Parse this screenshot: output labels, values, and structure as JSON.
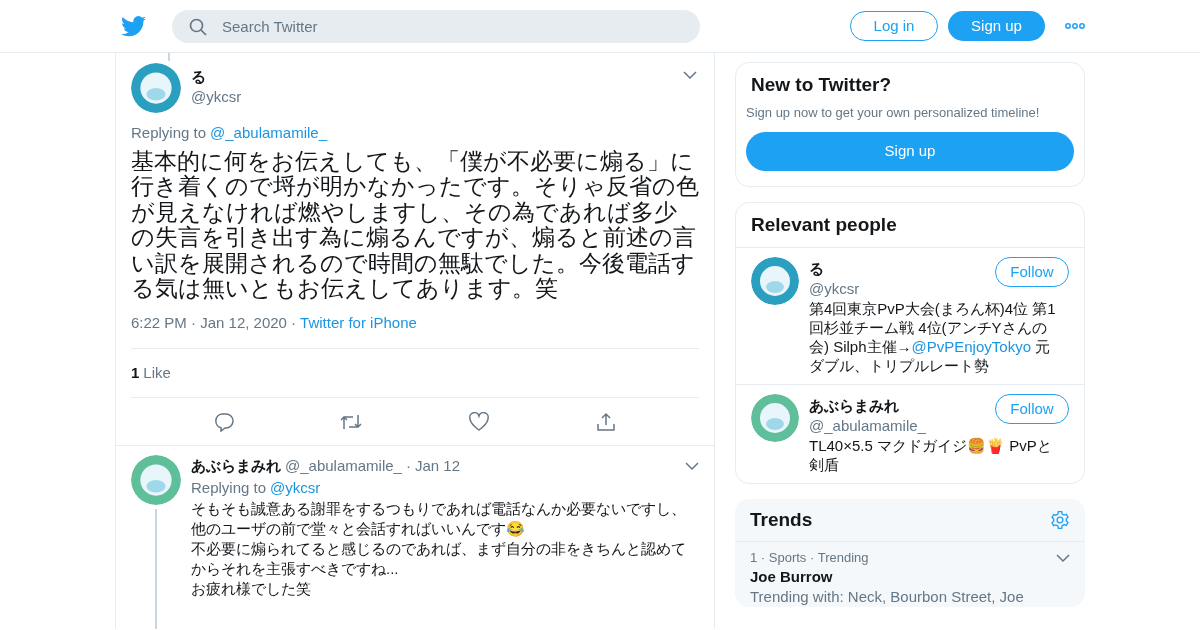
{
  "header": {
    "search_placeholder": "Search Twitter",
    "login": "Log in",
    "signup": "Sign up"
  },
  "main_tweet": {
    "name": "る",
    "handle": "@ykcsr",
    "replying_label": "Replying to",
    "replying_to": "@_abulamamile_",
    "text_lines": [
      "基本的に何をお伝えしても、「僕が不必要に煽る」に",
      "行き着くので埒が明かなかったです。そりゃ反省の色",
      "が見えなければ燃やしますし、その為であれば多少",
      "の失言を引き出す為に煽るんですが、煽ると前述の言",
      "い訳を展開されるので時間の無駄でした。今後電話す",
      "る気は無いともお伝えしてあります。笑"
    ],
    "time": "6:22 PM · Jan 12, 2020 ·",
    "source": "Twitter for iPhone",
    "like_count": "1",
    "like_label": "Like"
  },
  "reply": {
    "name": "あぶらまみれ",
    "handle": "@_abulamamile_",
    "separator": "·",
    "date": "Jan 12",
    "replying_label": "Replying to",
    "replying_to": "@ykcsr",
    "lines": [
      "そもそも誠意ある謝罪をするつもりであれば電話なんか必要ないですし、",
      "他のユーザの前で堂々と会話すればいいんです😂",
      "不必要に煽られてると感じるのであれば、まず自分の非をきちんと認めて",
      "からそれを主張すべきですね...",
      "お疲れ様でした笑"
    ]
  },
  "new_to_twitter": {
    "title": "New to Twitter?",
    "subtitle": "Sign up now to get your own personalized timeline!",
    "button": "Sign up"
  },
  "relevant_people": {
    "title": "Relevant people",
    "people": [
      {
        "name": "る",
        "handle": "@ykcsr",
        "follow": "Follow",
        "color": "#2a9fc0",
        "bio": [
          {
            "kind": "text",
            "text": "第4回東京PvP大会(まろん杯)4位 第1回杉並チーム戦 4位(アンチYさんの会) Silph主催→"
          },
          {
            "kind": "link",
            "text": "@PvPEnjoyTokyo"
          },
          {
            "kind": "text",
            "text": " 元ダブル、トリプルレート勢"
          }
        ]
      },
      {
        "name": "あぶらまみれ",
        "handle": "@_abulamamile_",
        "follow": "Follow",
        "color": "#5fbf9a",
        "bio": [
          {
            "kind": "text",
            "text": "TL40×5.5 マクドガイジ🍔🍟 PvPと剣盾"
          }
        ]
      }
    ]
  },
  "trends": {
    "title": "Trends",
    "items": [
      {
        "meta": "1 · Sports · Trending",
        "name": "Joe Burrow",
        "detail": "Trending with: Neck, Bourbon Street, Joe"
      }
    ]
  }
}
